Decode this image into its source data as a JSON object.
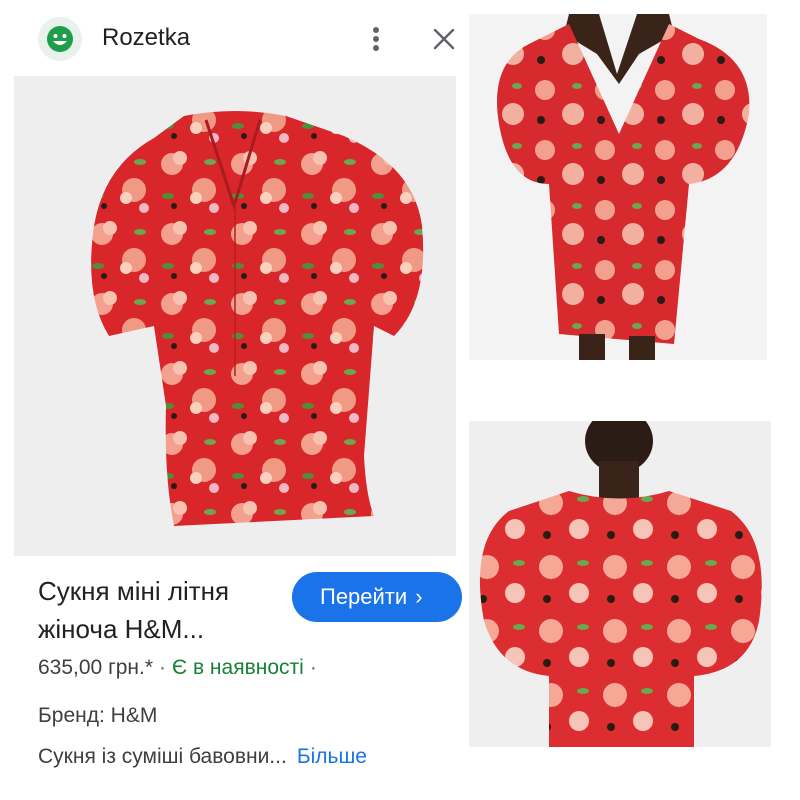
{
  "header": {
    "site_name": "Rozetka",
    "icons": {
      "avatar": "rozetka-smiley-icon",
      "menu": "more-vert-icon",
      "close": "close-icon"
    }
  },
  "product": {
    "title_line1": "Сукня міні літня",
    "title_line2": "жіноча H&M...",
    "go_button": "Перейти",
    "go_chevron": "›",
    "price": "635,00 грн.*",
    "separator": "·",
    "availability": "Є в наявності",
    "brand": "Бренд: H&M",
    "description": "Сукня із суміші бавовни...",
    "more_link": "Більше"
  },
  "colors": {
    "accent": "#1a73e8",
    "stock_green": "#188038",
    "dress_red": "#d8262a",
    "flower_pink": "#f4a08f",
    "leaf_green": "#6aa84f"
  }
}
